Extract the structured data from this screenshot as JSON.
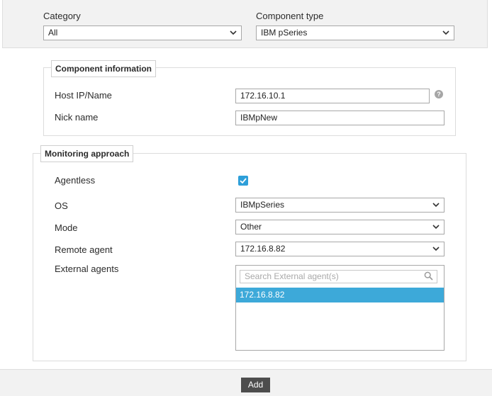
{
  "filters": {
    "category": {
      "label": "Category",
      "value": "All"
    },
    "component_type": {
      "label": "Component type",
      "value": "IBM pSeries"
    }
  },
  "component_information": {
    "legend": "Component information",
    "host": {
      "label": "Host IP/Name",
      "value": "172.16.10.1",
      "help_icon": "question-circle"
    },
    "nick": {
      "label": "Nick name",
      "value": "IBMpNew"
    }
  },
  "monitoring_approach": {
    "legend": "Monitoring approach",
    "agentless": {
      "label": "Agentless",
      "checked": true
    },
    "os": {
      "label": "OS",
      "value": "IBMpSeries"
    },
    "mode": {
      "label": "Mode",
      "value": "Other"
    },
    "remote_agent": {
      "label": "Remote agent",
      "value": "172.16.8.82"
    },
    "external_agents": {
      "label": "External agents",
      "search_placeholder": "Search External agent(s)",
      "items": [
        "172.16.8.82"
      ]
    }
  },
  "footer": {
    "add_label": "Add"
  },
  "colors": {
    "accent": "#3da9d9",
    "checkbox": "#2e9fd9",
    "button": "#4d4d4d",
    "panel": "#f2f2f2"
  }
}
